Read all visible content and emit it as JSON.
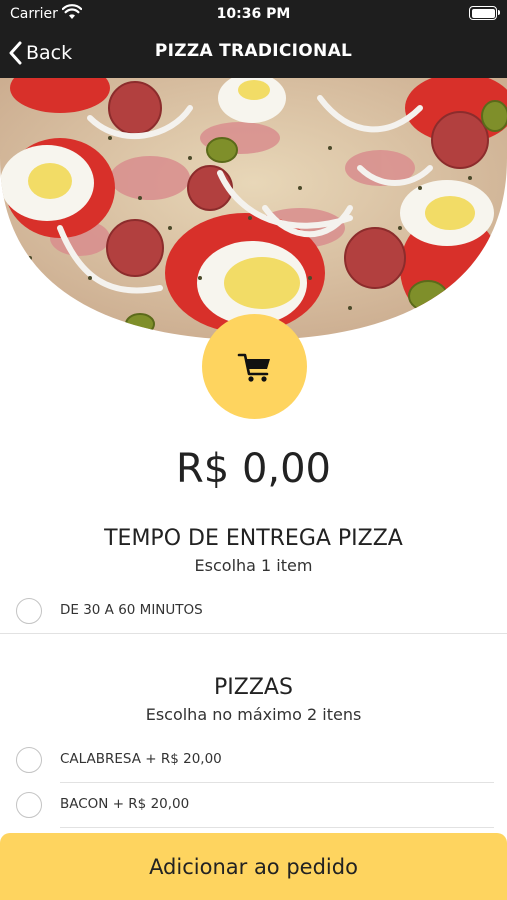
{
  "status_bar": {
    "carrier": "Carrier",
    "time": "10:36 PM"
  },
  "nav": {
    "back_label": "Back",
    "title": "PIZZA TRADICIONAL"
  },
  "hero": {
    "image": "pizza-photo"
  },
  "product": {
    "price": "R$ 0,00"
  },
  "groups": [
    {
      "title": "TEMPO DE ENTREGA PIZZA",
      "subtitle": "Escolha 1 item",
      "options": [
        {
          "label": "DE 30 A 60 MINUTOS",
          "selected": false
        }
      ]
    },
    {
      "title": "PIZZAS",
      "subtitle": "Escolha no máximo 2 itens",
      "options": [
        {
          "label": "CALABRESA + R$ 20,00",
          "selected": false
        },
        {
          "label": "BACON + R$ 20,00",
          "selected": false
        }
      ]
    }
  ],
  "footer": {
    "add_label": "Adicionar ao pedido"
  },
  "colors": {
    "accent": "#fed45f",
    "bar": "#1e1e1e",
    "text": "#222222",
    "radio_border": "#c4c4c4"
  },
  "icons": [
    "wifi-icon",
    "battery-icon",
    "chevron-left-icon",
    "cart-icon"
  ]
}
